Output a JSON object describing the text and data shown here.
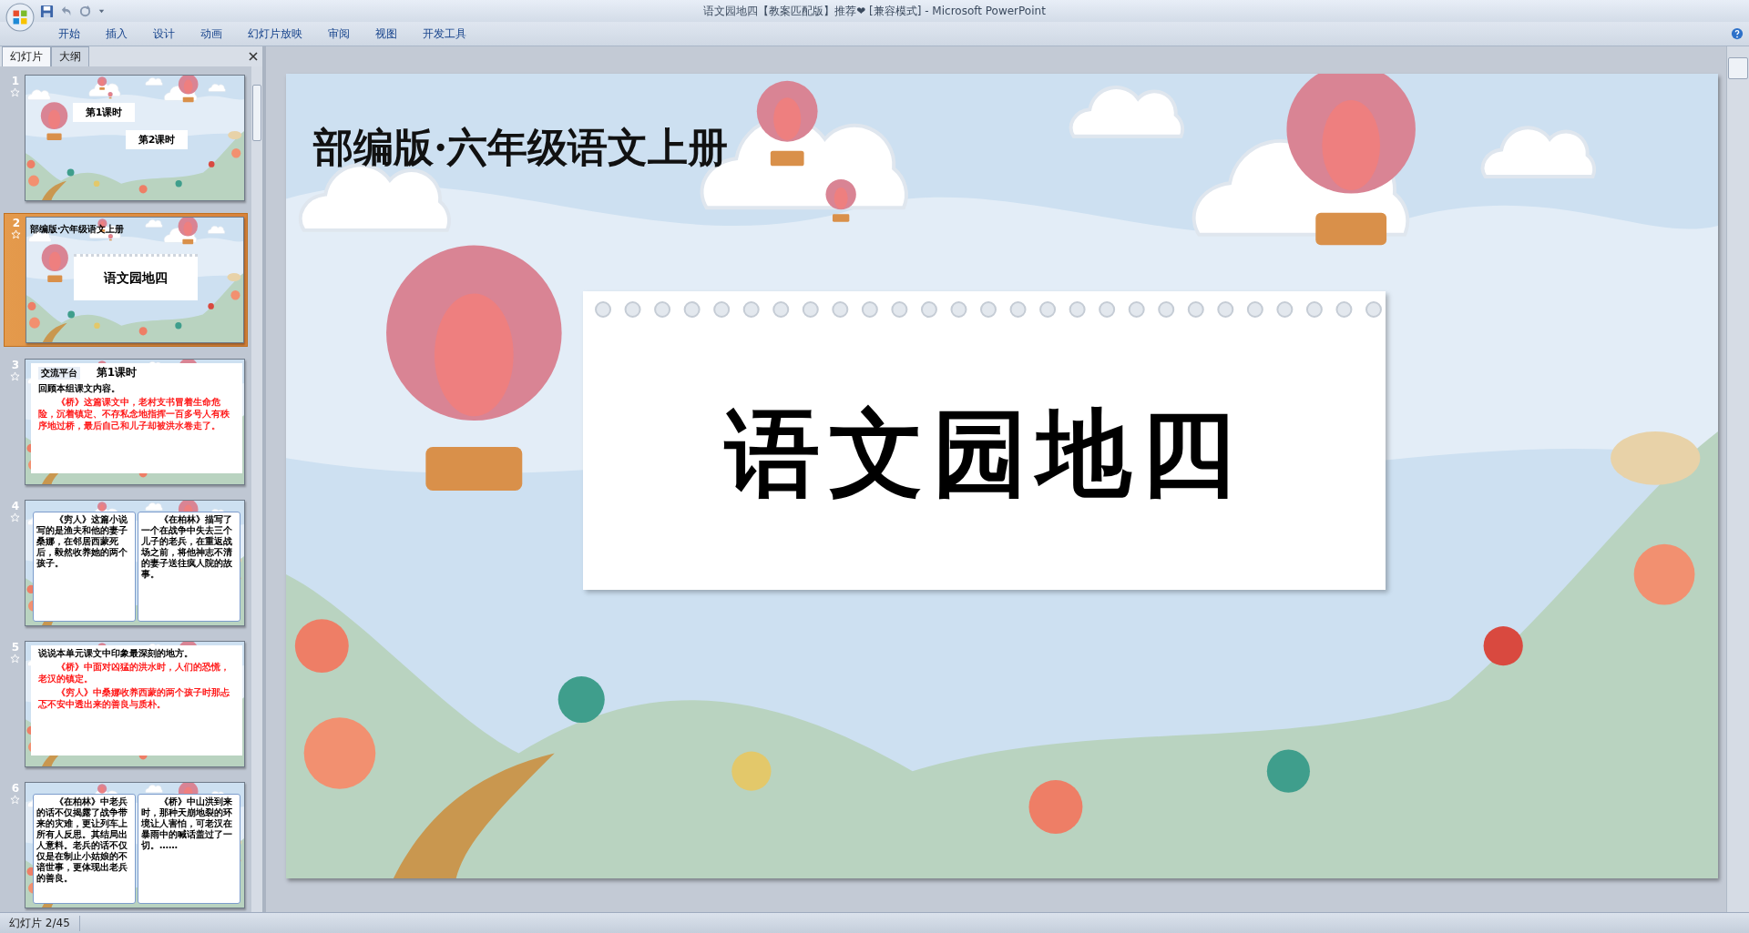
{
  "window": {
    "title": "语文园地四【教案匹配版】推荐❤ [兼容模式] - Microsoft PowerPoint"
  },
  "ribbon_tabs": [
    {
      "label": "开始"
    },
    {
      "label": "插入"
    },
    {
      "label": "设计"
    },
    {
      "label": "动画"
    },
    {
      "label": "幻灯片放映"
    },
    {
      "label": "审阅"
    },
    {
      "label": "视图"
    },
    {
      "label": "开发工具"
    }
  ],
  "panel_tabs": [
    {
      "label": "幻灯片",
      "selected": true
    },
    {
      "label": "大纲",
      "selected": false
    }
  ],
  "slides": [
    {
      "number": "1",
      "selected": false,
      "kind": "lessons",
      "texts": [
        "第1课时",
        "第2课时"
      ]
    },
    {
      "number": "2",
      "selected": true,
      "kind": "cover",
      "texts": [
        "部编版·六年级语文上册",
        "语文园地四"
      ]
    },
    {
      "number": "3",
      "selected": false,
      "kind": "notes",
      "texts": [
        "交流平台",
        "第1课时",
        "回顾本组课文内容。",
        "《桥》这篇课文中，老村支书冒着生命危险，沉着镇定、不存私念地指挥一百多号人有秩序地过桥，最后自己和儿子却被洪水卷走了。"
      ]
    },
    {
      "number": "4",
      "selected": false,
      "kind": "columns",
      "texts": [
        "《穷人》这篇小说写的是渔夫和他的妻子桑娜，在邻居西蒙死后，毅然收养她的两个孩子。",
        "《在柏林》描写了一个在战争中失去三个儿子的老兵，在重返战场之前，将他神志不清的妻子送往疯人院的故事。"
      ]
    },
    {
      "number": "5",
      "selected": false,
      "kind": "points",
      "texts": [
        "说说本单元课文中印象最深刻的地方。",
        "《桥》中面对凶猛的洪水时，人们的恐慌，老汉的镇定。",
        "《穷人》中桑娜收养西蒙的两个孩子时那忐忑不安中透出来的善良与质朴。"
      ]
    },
    {
      "number": "6",
      "selected": false,
      "kind": "columns",
      "texts": [
        "《在柏林》中老兵的话不仅揭露了战争带来的灾难，更让列车上所有人反思。其结局出人意料。老兵的话不仅仅是在制止小姑娘的不谙世事，更体现出老兵的善良。",
        "《桥》中山洪到来时，那种天崩地裂的环境让人害怕，可老汉在暴雨中的喊话盖过了一切。……"
      ]
    }
  ],
  "main_slide": {
    "subtitle": "部编版·六年级语文上册",
    "title": "语文园地四"
  },
  "status_bar": {
    "slide_counter": "幻灯片 2/45"
  }
}
